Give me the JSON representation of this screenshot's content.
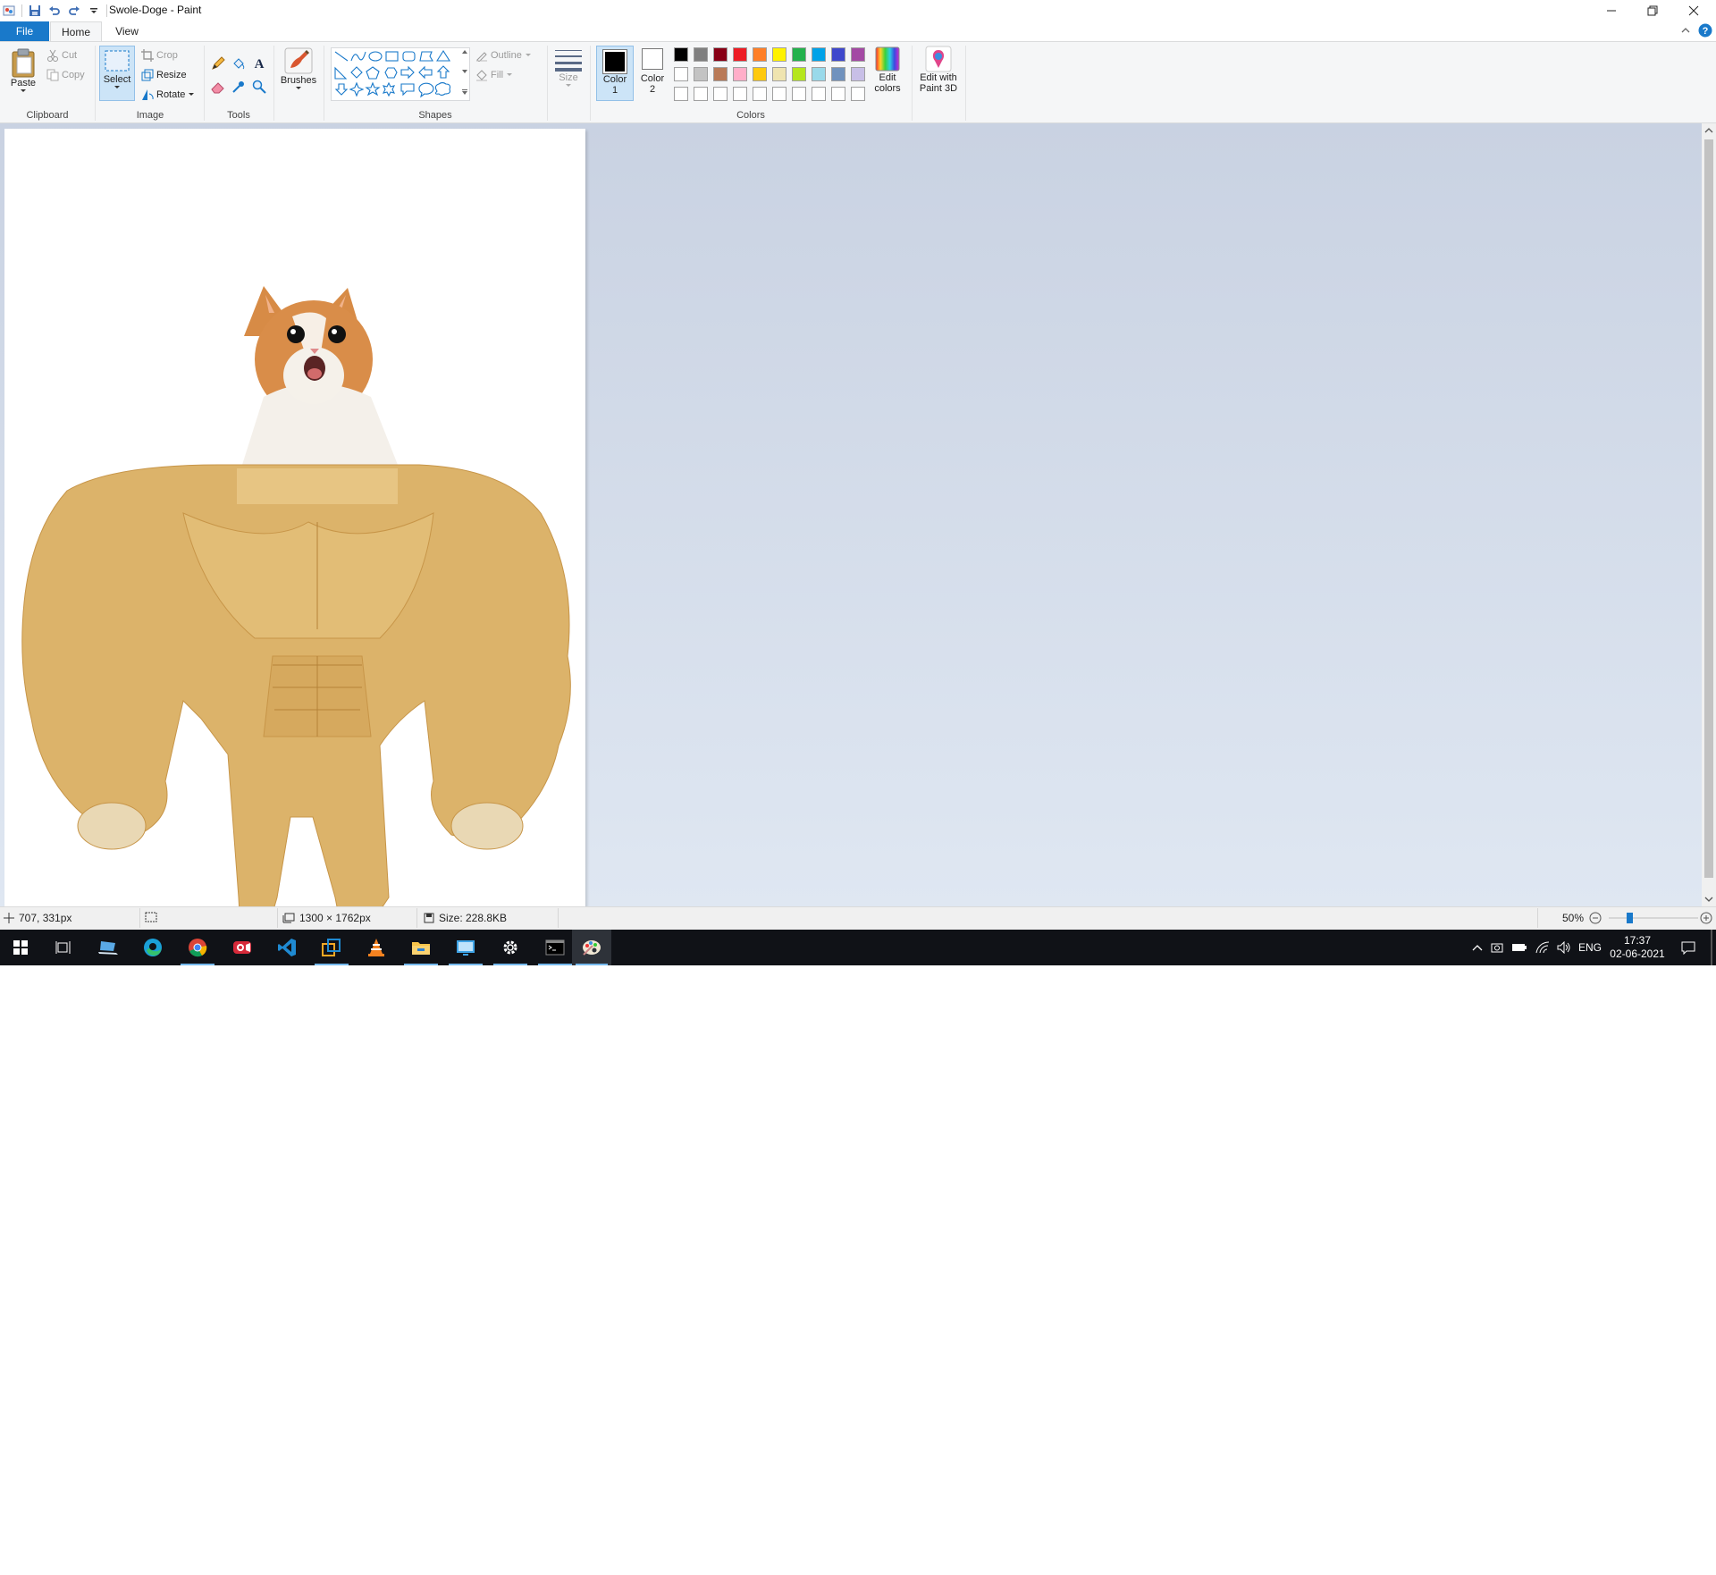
{
  "window": {
    "title": "Swole-Doge - Paint"
  },
  "tabs": [
    {
      "label": "File"
    },
    {
      "label": "Home"
    },
    {
      "label": "View"
    }
  ],
  "ribbon": {
    "clipboard": {
      "paste": "Paste",
      "cut": "Cut",
      "copy": "Copy",
      "group": "Clipboard"
    },
    "image": {
      "select": "Select",
      "crop": "Crop",
      "resize": "Resize",
      "rotate": "Rotate",
      "group": "Image"
    },
    "tools": {
      "group": "Tools"
    },
    "brushes": {
      "label": "Brushes"
    },
    "shapes": {
      "outline": "Outline",
      "fill": "Fill",
      "group": "Shapes"
    },
    "size": {
      "label": "Size"
    },
    "colors": {
      "color1": "Color 1",
      "color2": "Color 2",
      "edit": "Edit colors",
      "paint3d": "Edit with Paint 3D",
      "group": "Colors",
      "color1_value": "#000000",
      "color2_value": "#ffffff",
      "palette_row1": [
        "#000000",
        "#7f7f7f",
        "#880015",
        "#ed1c24",
        "#ff7f27",
        "#fff200",
        "#22b14c",
        "#00a2e8",
        "#3f48cc",
        "#a349a4"
      ],
      "palette_row2": [
        "#ffffff",
        "#c3c3c3",
        "#b97a57",
        "#ffaec9",
        "#ffc90e",
        "#efe4b0",
        "#b5e61d",
        "#99d9ea",
        "#7092be",
        "#c8bfe7"
      ],
      "palette_row3": [
        "#ffffff",
        "#ffffff",
        "#ffffff",
        "#ffffff",
        "#ffffff",
        "#ffffff",
        "#ffffff",
        "#ffffff",
        "#ffffff",
        "#ffffff"
      ]
    }
  },
  "status": {
    "cursor": "707, 331px",
    "dimensions": "1300 × 1762px",
    "size": "Size: 228.8KB",
    "zoom": "50%"
  },
  "taskbar": {
    "lang": "ENG",
    "time": "17:37",
    "date": "02-06-2021"
  }
}
